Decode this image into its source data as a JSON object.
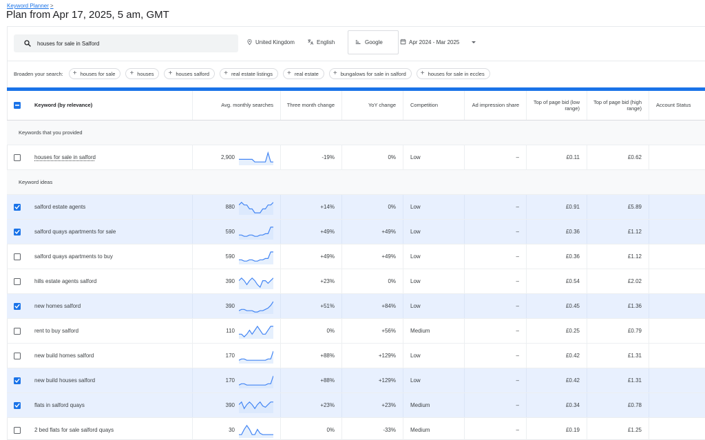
{
  "breadcrumb": {
    "label": "Keyword Planner",
    "separator": ">"
  },
  "page_title": "Plan from Apr 17, 2025, 5 am, GMT",
  "search": {
    "value": "houses for sale in Salford"
  },
  "filters": {
    "location": "United Kingdom",
    "language": "English",
    "network": "Google",
    "date_range": "Apr 2024 - Mar 2025"
  },
  "broaden": {
    "label": "Broaden your search:",
    "chips": [
      "houses for sale",
      "houses",
      "houses salford",
      "real estate listings",
      "real estate",
      "bungalows for sale in salford",
      "houses for sale in eccles"
    ]
  },
  "table": {
    "headers": {
      "keyword": "Keyword (by relevance)",
      "avg": "Avg. monthly searches",
      "three_month": "Three month change",
      "yoy": "YoY change",
      "competition": "Competition",
      "impression": "Ad impression share",
      "bid_low": "Top of page bid (low range)",
      "bid_high": "Top of page bid (high range)",
      "account": "Account Status"
    },
    "section_provided": "Keywords that you provided",
    "section_ideas": "Keyword ideas",
    "provided_rows": [
      {
        "keyword": "houses for sale in salford",
        "avg": "2,900",
        "three_month": "-19%",
        "yoy": "0%",
        "competition": "Low",
        "impression": "–",
        "bid_low": "£0.11",
        "bid_high": "£0.62",
        "checked": false,
        "trend": [
          4,
          4,
          4,
          4,
          4,
          4,
          2,
          2,
          2,
          2,
          2,
          9,
          2,
          2
        ]
      }
    ],
    "idea_rows": [
      {
        "keyword": "salford estate agents",
        "avg": "880",
        "three_month": "+14%",
        "yoy": "0%",
        "competition": "Low",
        "impression": "–",
        "bid_low": "£0.91",
        "bid_high": "£5.89",
        "checked": true,
        "trend": [
          7,
          9,
          7,
          7,
          4,
          4,
          1,
          1,
          1,
          4,
          4,
          7,
          7,
          9
        ]
      },
      {
        "keyword": "salford quays apartments for sale",
        "avg": "590",
        "three_month": "+49%",
        "yoy": "+49%",
        "competition": "Low",
        "impression": "–",
        "bid_low": "£0.36",
        "bid_high": "£1.12",
        "checked": true,
        "trend": [
          3,
          3,
          2,
          2,
          3,
          3,
          2,
          2,
          3,
          3,
          4,
          4,
          9,
          9
        ]
      },
      {
        "keyword": "salford quays apartments to buy",
        "avg": "590",
        "three_month": "+49%",
        "yoy": "+49%",
        "competition": "Low",
        "impression": "–",
        "bid_low": "£0.36",
        "bid_high": "£1.12",
        "checked": false,
        "trend": [
          3,
          3,
          2,
          2,
          3,
          3,
          2,
          2,
          3,
          3,
          4,
          4,
          9,
          9
        ]
      },
      {
        "keyword": "hills estate agents salford",
        "avg": "390",
        "three_month": "+23%",
        "yoy": "0%",
        "competition": "Low",
        "impression": "–",
        "bid_low": "£0.54",
        "bid_high": "£2.02",
        "checked": false,
        "trend": [
          6,
          8,
          6,
          3,
          6,
          8,
          6,
          3,
          1,
          6,
          6,
          4,
          6,
          8
        ]
      },
      {
        "keyword": "new homes salford",
        "avg": "390",
        "three_month": "+51%",
        "yoy": "+84%",
        "competition": "Low",
        "impression": "–",
        "bid_low": "£0.45",
        "bid_high": "£1.36",
        "checked": true,
        "trend": [
          2,
          3,
          3,
          2,
          2,
          2,
          1,
          1,
          2,
          2,
          3,
          4,
          6,
          9
        ]
      },
      {
        "keyword": "rent to buy salford",
        "avg": "110",
        "three_month": "0%",
        "yoy": "+56%",
        "competition": "Medium",
        "impression": "–",
        "bid_low": "£0.25",
        "bid_high": "£0.79",
        "checked": false,
        "trend": [
          3,
          3,
          1,
          3,
          6,
          3,
          6,
          9,
          6,
          3,
          3,
          6,
          9,
          9
        ]
      },
      {
        "keyword": "new build homes salford",
        "avg": "170",
        "three_month": "+88%",
        "yoy": "+129%",
        "competition": "Low",
        "impression": "–",
        "bid_low": "£0.42",
        "bid_high": "£1.31",
        "checked": false,
        "trend": [
          2,
          3,
          3,
          2,
          2,
          2,
          2,
          2,
          2,
          2,
          2,
          3,
          3,
          9
        ]
      },
      {
        "keyword": "new build houses salford",
        "avg": "170",
        "three_month": "+88%",
        "yoy": "+129%",
        "competition": "Low",
        "impression": "–",
        "bid_low": "£0.42",
        "bid_high": "£1.31",
        "checked": true,
        "trend": [
          2,
          3,
          3,
          2,
          2,
          2,
          2,
          2,
          2,
          2,
          2,
          3,
          3,
          9
        ]
      },
      {
        "keyword": "flats in salford quays",
        "avg": "390",
        "three_month": "+23%",
        "yoy": "+23%",
        "competition": "Medium",
        "impression": "–",
        "bid_low": "£0.34",
        "bid_high": "£0.78",
        "checked": true,
        "trend": [
          6,
          8,
          3,
          6,
          8,
          6,
          3,
          6,
          8,
          5,
          4,
          6,
          8,
          8
        ]
      },
      {
        "keyword": "2 bed flats for sale salford quays",
        "avg": "30",
        "three_month": "0%",
        "yoy": "-33%",
        "competition": "Medium",
        "impression": "–",
        "bid_low": "£0.19",
        "bid_high": "£1.25",
        "checked": false,
        "trend": [
          2,
          2,
          6,
          9,
          6,
          2,
          2,
          6,
          3,
          2,
          2,
          2,
          2,
          2
        ]
      }
    ]
  },
  "colors": {
    "accent": "#1a73e8",
    "selected_row": "#e8f0fe",
    "trend_line": "#4285f4",
    "trend_fill": "#d2e3fc"
  },
  "icons": {
    "search": "search-icon",
    "location": "location-pin-icon",
    "language": "translate-icon",
    "network": "network-icon",
    "calendar": "calendar-icon",
    "dropdown": "dropdown-caret-icon",
    "add": "plus-icon",
    "checkbox": "checkbox-icon"
  }
}
